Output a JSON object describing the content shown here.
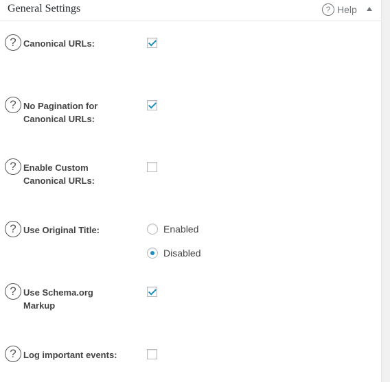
{
  "panel": {
    "title": "General Settings",
    "help_label": "Help",
    "help_icon": "question-circle-icon",
    "collapse_icon": "triangle-up-icon"
  },
  "settings": [
    {
      "label": "Canonical URLs:",
      "type": "checkbox",
      "checked": true
    },
    {
      "label": "No Pagination for Canonical URLs:",
      "type": "checkbox",
      "checked": true
    },
    {
      "label": "Enable Custom Canonical URLs:",
      "type": "checkbox",
      "checked": false
    },
    {
      "label": "Use Original Title:",
      "type": "radio",
      "options": [
        {
          "label": "Enabled",
          "selected": false
        },
        {
          "label": "Disabled",
          "selected": true
        }
      ]
    },
    {
      "label": "Use Schema.org Markup",
      "type": "checkbox",
      "checked": true
    },
    {
      "label": "Log important events:",
      "type": "checkbox",
      "checked": false
    }
  ],
  "colors": {
    "accent": "#1e8cbe"
  }
}
